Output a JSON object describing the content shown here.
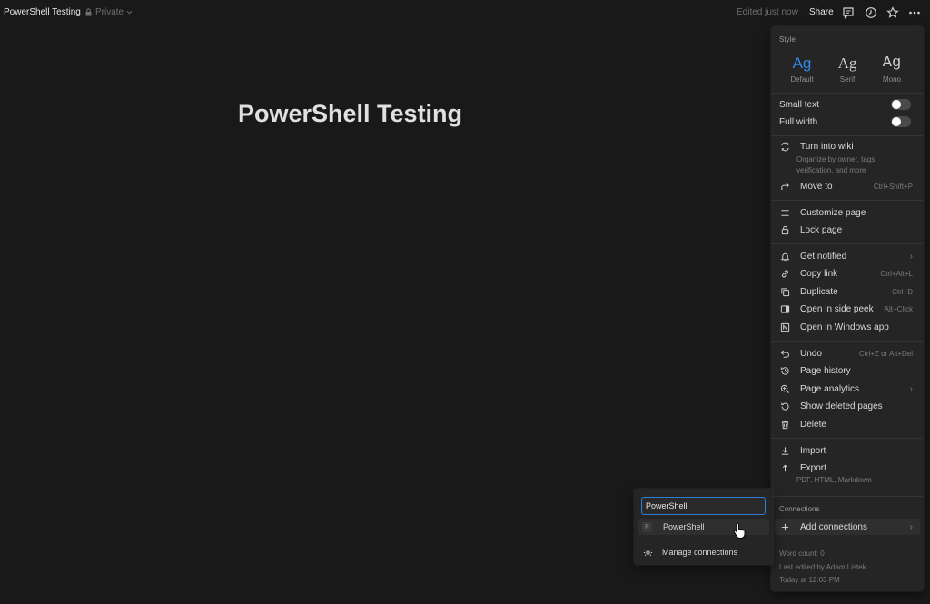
{
  "topbar": {
    "title": "PowerShell Testing",
    "privacy": "Private",
    "edited": "Edited just now",
    "share": "Share",
    "icons": [
      "comment-icon",
      "clock-icon",
      "star-icon",
      "more-icon"
    ]
  },
  "page": {
    "title": "PowerShell Testing"
  },
  "menu": {
    "style_label": "Style",
    "styles": [
      {
        "glyph": "Ag",
        "label": "Default",
        "active": true
      },
      {
        "glyph": "Ag",
        "label": "Serif",
        "active": false
      },
      {
        "glyph": "Ag",
        "label": "Mono",
        "active": false
      }
    ],
    "small_text": "Small text",
    "full_width": "Full width",
    "turn_into_wiki": "Turn into wiki",
    "turn_into_wiki_sub": "Organize by owner, tags, verification, and more",
    "move_to": "Move to",
    "move_to_sc": "Ctrl+Shift+P",
    "customize_page": "Customize page",
    "lock_page": "Lock page",
    "get_notified": "Get notified",
    "copy_link": "Copy link",
    "copy_link_sc": "Ctrl+Alt+L",
    "duplicate": "Duplicate",
    "duplicate_sc": "Ctrl+D",
    "open_side_peek": "Open in side peek",
    "open_side_peek_sc": "Alt+Click",
    "open_windows_app": "Open in Windows app",
    "undo": "Undo",
    "undo_sc": "Ctrl+Z or Alt+Del",
    "page_history": "Page history",
    "page_analytics": "Page analytics",
    "show_deleted": "Show deleted pages",
    "delete": "Delete",
    "import": "Import",
    "export": "Export",
    "export_sub": "PDF, HTML, Markdown",
    "connections_label": "Connections",
    "add_connections": "Add connections",
    "word_count": "Word count: 0",
    "last_edited": "Last edited by Adam Listek",
    "last_edited_time": "Today at 12:03 PM"
  },
  "popup": {
    "search_value": "PowerShell",
    "result_badge": "P",
    "result_label": "PowerShell",
    "manage": "Manage connections"
  },
  "colors": {
    "accent": "#2e8ae6",
    "background": "#191919",
    "menu_bg": "#252525"
  }
}
